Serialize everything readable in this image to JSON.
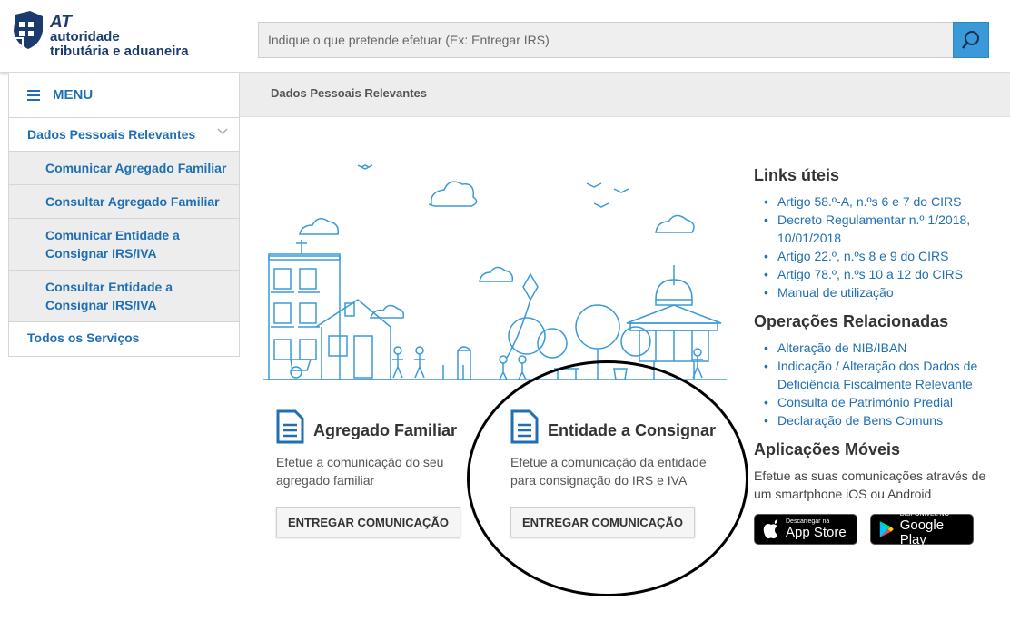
{
  "logo": {
    "line1": "AT",
    "line2": "autoridade",
    "line3": "tributária e aduaneira"
  },
  "search": {
    "placeholder": "Indique o que pretende efetuar (Ex: Entregar IRS)"
  },
  "menu": {
    "label": "MENU"
  },
  "sidebar": {
    "parent": "Dados Pessoais Relevantes",
    "items": [
      {
        "label": "Comunicar Agregado Familiar"
      },
      {
        "label": "Consultar Agregado Familiar"
      },
      {
        "label": "Comunicar Entidade a Consignar IRS/IVA"
      },
      {
        "label": "Consultar Entidade a Consignar IRS/IVA"
      }
    ],
    "all_services": "Todos os Serviços"
  },
  "breadcrumb": "Dados Pessoais Relevantes",
  "cards": [
    {
      "title": "Agregado Familiar",
      "desc": "Efetue a comunicação do seu agregado familiar",
      "button": "ENTREGAR COMUNICAÇÃO"
    },
    {
      "title": "Entidade a Consignar",
      "desc": "Efetue a comunicação da entidade para consignação do IRS e IVA",
      "button": "ENTREGAR COMUNICAÇÃO"
    }
  ],
  "links_uteis": {
    "title": "Links úteis",
    "items": [
      "Artigo 58.º-A, n.ºs 6 e 7 do CIRS",
      "Decreto Regulamentar n.º 1/2018, 10/01/2018",
      "Artigo 22.º, n.ºs 8 e 9 do CIRS",
      "Artigo 78.º, n.ºs 10 a 12 do CIRS",
      "Manual de utilização"
    ]
  },
  "operacoes": {
    "title": "Operações Relacionadas",
    "items": [
      "Alteração de NIB/IBAN",
      "Indicação / Alteração dos Dados de Deficiência Fiscalmente Relevante",
      "Consulta de Património Predial",
      "Declaração de Bens Comuns"
    ]
  },
  "apps": {
    "title": "Aplicações Móveis",
    "desc": "Efetue as suas comunicações através de um smartphone iOS ou Android",
    "apple_small": "Descarregar na",
    "apple_big": "App Store",
    "google_small": "DISPONÍVEL NO",
    "google_big": "Google Play"
  },
  "colors": {
    "brand": "#1b3b6f",
    "link": "#1f6fb2",
    "search_button": "#3a9ad9",
    "illustration": "#3a9ad9"
  }
}
